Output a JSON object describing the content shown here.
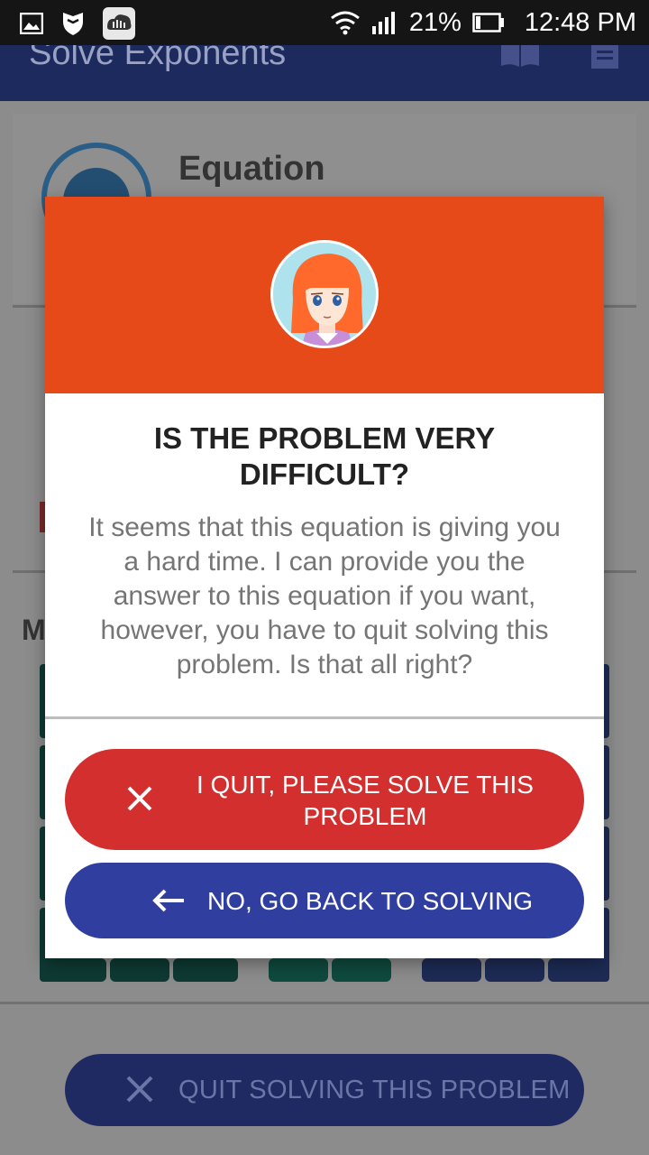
{
  "status_bar": {
    "battery": "21%",
    "time": "12:48 PM",
    "left_icons": [
      "gallery-icon",
      "shield-icon",
      "cloud-music-icon"
    ],
    "right_icons": [
      "wifi-icon",
      "signal-icon",
      "battery-icon"
    ]
  },
  "app_bar": {
    "title": "Solve Exponents",
    "icons": [
      "book-icon",
      "document-icon"
    ]
  },
  "background": {
    "card_title": "Equation",
    "section_label": "M",
    "quit_button_label": "QUIT SOLVING THIS PROBLEM"
  },
  "dialog": {
    "title": "IS THE PROBLEM VERY DIFFICULT?",
    "message": "It seems that this equation is giving you a hard time. I can provide you the answer to this equation if you want, however, you have to quit solving this problem. Is that all right?",
    "quit_button_label": "I QUIT, PLEASE SOLVE THIS PROBLEM",
    "back_button_label": "NO, GO BACK TO SOLVING",
    "colors": {
      "header": "#e64a19",
      "quit_button": "#d32f2f",
      "back_button": "#303f9f"
    }
  }
}
